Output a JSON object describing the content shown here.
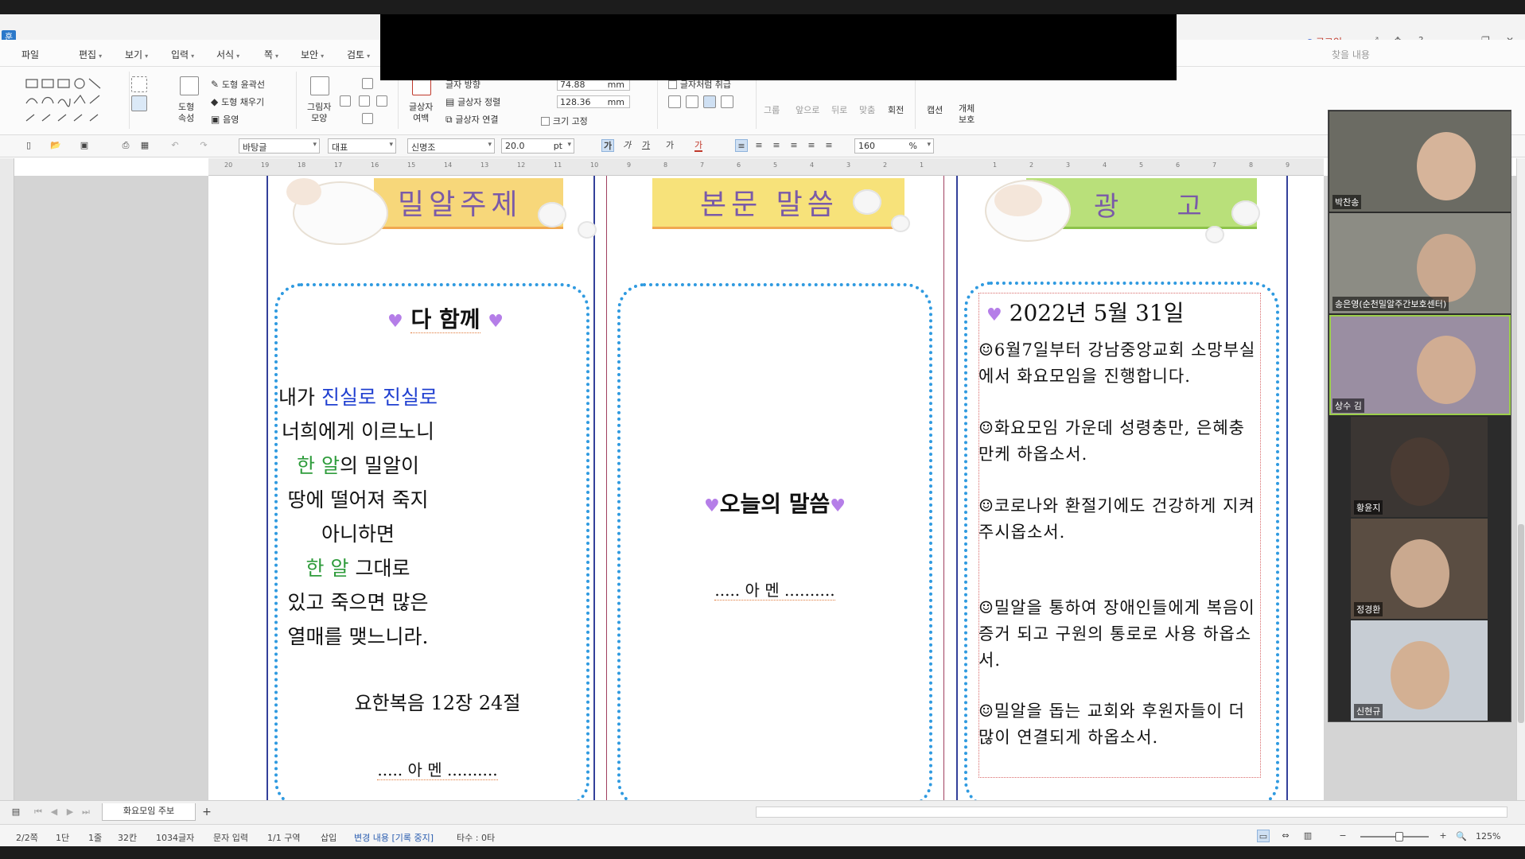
{
  "window": {
    "login": "로그인",
    "ctrl_icons": [
      "expand-icon",
      "move-icon",
      "help-icon",
      "minimize-icon",
      "restore-icon",
      "close-icon"
    ]
  },
  "menu": [
    {
      "label": "파일",
      "caret": false
    },
    {
      "label": "편집",
      "caret": true
    },
    {
      "label": "보기",
      "caret": true
    },
    {
      "label": "입력",
      "caret": true
    },
    {
      "label": "서식",
      "caret": true
    },
    {
      "label": "쪽",
      "caret": true
    },
    {
      "label": "보안",
      "caret": true
    },
    {
      "label": "검토",
      "caret": true
    }
  ],
  "menu_right": "찾을 내용",
  "ribbon": {
    "shape_props": "도형\n속성",
    "outline": "도형 윤곽선",
    "fill": "도형 채우기",
    "shadow": "음영",
    "picture_shape": "그림자\n모양",
    "margin": "글상자\n여백",
    "text_direction": "글자 방향",
    "text_align": "글상자 정렬",
    "text_link": "글상자 연결",
    "width": "74.88",
    "height": "128.36",
    "unit": "mm",
    "fix_size": "크기 고정",
    "treat_as_char": "글자처럼 취급",
    "group": "그룹",
    "front": "앞으로",
    "back": "뒤로",
    "align": "맞춤",
    "rotate": "회전",
    "caption": "캡션",
    "protect": "개체\n보호"
  },
  "toolbar": {
    "style": "바탕글",
    "para": "대표",
    "font": "신명조",
    "size": "20.0",
    "size_unit": "pt",
    "zoom": "160",
    "zoom_unit": "%",
    "bold": "가",
    "italic": "가",
    "underline": "가",
    "strike": "가",
    "color": "가"
  },
  "ruler_ticks": [
    "20",
    "19",
    "18",
    "17",
    "16",
    "15",
    "14",
    "13",
    "12",
    "11",
    "10",
    "9",
    "8",
    "7",
    "6",
    "5",
    "4",
    "3",
    "2",
    "1",
    "",
    "1",
    "2",
    "3",
    "4",
    "5",
    "6",
    "7",
    "8",
    "9"
  ],
  "columns": {
    "left_title": "밀알주제",
    "mid_title": "본문 말씀",
    "right_title": "광    고"
  },
  "left": {
    "heading": "다 함께",
    "poem_lines": [
      [
        {
          "t": "내가 ",
          "c": ""
        },
        {
          "t": "진실로 진실로",
          "c": "blue"
        }
      ],
      [
        {
          "t": "너희에게 이르노니",
          "c": ""
        }
      ],
      [
        {
          "t": "한 알",
          "c": "green"
        },
        {
          "t": "의 밀알이",
          "c": ""
        }
      ],
      [
        {
          "t": "땅에 떨어져 죽지",
          "c": ""
        }
      ],
      [
        {
          "t": "아니하면",
          "c": ""
        }
      ],
      [
        {
          "t": "한 알",
          "c": "green"
        },
        {
          "t": " 그대로",
          "c": ""
        }
      ],
      [
        {
          "t": "있고 죽으면 많은",
          "c": ""
        }
      ],
      [
        {
          "t": "열매를 맺느니라.",
          "c": ""
        }
      ]
    ],
    "reference": "요한복음 12장 24절",
    "amen": "..... 아 멘 .........."
  },
  "middle": {
    "heading": "오늘의 말씀",
    "amen": "..... 아 멘 .........."
  },
  "right": {
    "date": "2022년 5월 31일",
    "items": [
      "☺6월7일부터 강남중앙교회 소망부실에서 화요모임을 진행합니다.",
      "☺화요모임 가운데 성령충만, 은혜충만케 하옵소서.",
      "☺코로나와 환절기에도 건강하게 지켜 주시옵소서.",
      "☺밀알을 통하여 장애인들에게 복음이 증거 되고 구원의 통로로 사용 하옵소서.",
      "☺밀알을 돕는 교회와 후원자들이 더 많이 연결되게 하옵소서."
    ]
  },
  "video": {
    "participants": [
      {
        "name": "박찬송",
        "bg": "#6b6b63",
        "face": "#d6b49a",
        "active": false
      },
      {
        "name": "송은영(순천밀알주간보호센터)",
        "bg": "#8c8c84",
        "face": "#c9a88f",
        "active": false
      },
      {
        "name": "상수 김",
        "bg": "#9a8ea2",
        "face": "#d1ad93",
        "active": true
      },
      {
        "name": "황윤지",
        "bg": "#3b3633",
        "face": "#4a3b33",
        "active": false
      },
      {
        "name": "정경환",
        "bg": "#5a4d42",
        "face": "#caa98f",
        "active": false
      },
      {
        "name": "신현규",
        "bg": "#c7cdd4",
        "face": "#d3b093",
        "active": false
      }
    ]
  },
  "tabs": {
    "sheet": "화요모임 주보",
    "add": "+"
  },
  "status": {
    "page": "2/2쪽",
    "section": "1단",
    "line": "1줄",
    "col": "32칸",
    "chars": "1034글자",
    "mode": "문자 입력",
    "area": "1/1 구역",
    "insert": "삽입",
    "track": "변경 내용 [기록 중지]",
    "typing": "타수 : 0타",
    "zoom": "125%"
  },
  "colors": {
    "accent": "#2a5db0",
    "dot_border": "#2f9ae0",
    "heart": "#b57ee8",
    "blue_text": "#1f3fd0",
    "green_text": "#2f9c3c",
    "title_purple": "#7a5aa8"
  }
}
